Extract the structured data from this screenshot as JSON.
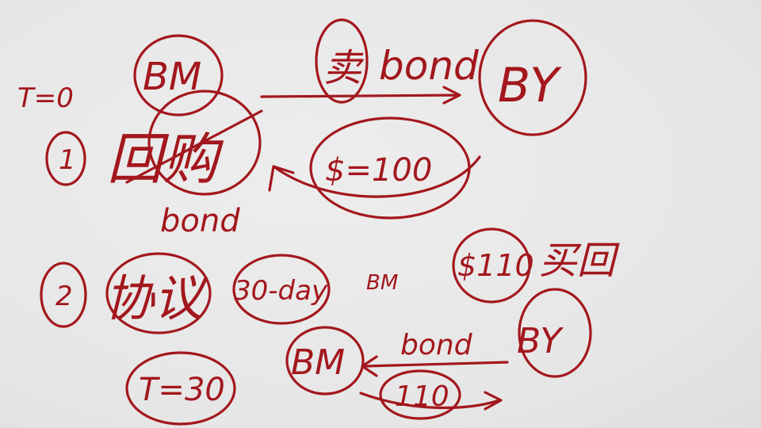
{
  "board": {
    "t_marker": "T=0",
    "step1": {
      "number": "1",
      "verb": "回购",
      "bond_note": "bond"
    },
    "top_flow": {
      "seller": "BM",
      "action": "卖",
      "item": "bond",
      "buyer": "BY",
      "cash": "$=100"
    },
    "step2": {
      "number": "2",
      "verb": "协议",
      "term": "30-day",
      "seller_note": "BM",
      "price": "$110",
      "tail": "买回"
    },
    "bottom_flow": {
      "seller": "BM",
      "item": "bond",
      "amount": "110",
      "counterparty": "BY",
      "t_end": "T=30"
    }
  },
  "ink_color": "#a3171d"
}
